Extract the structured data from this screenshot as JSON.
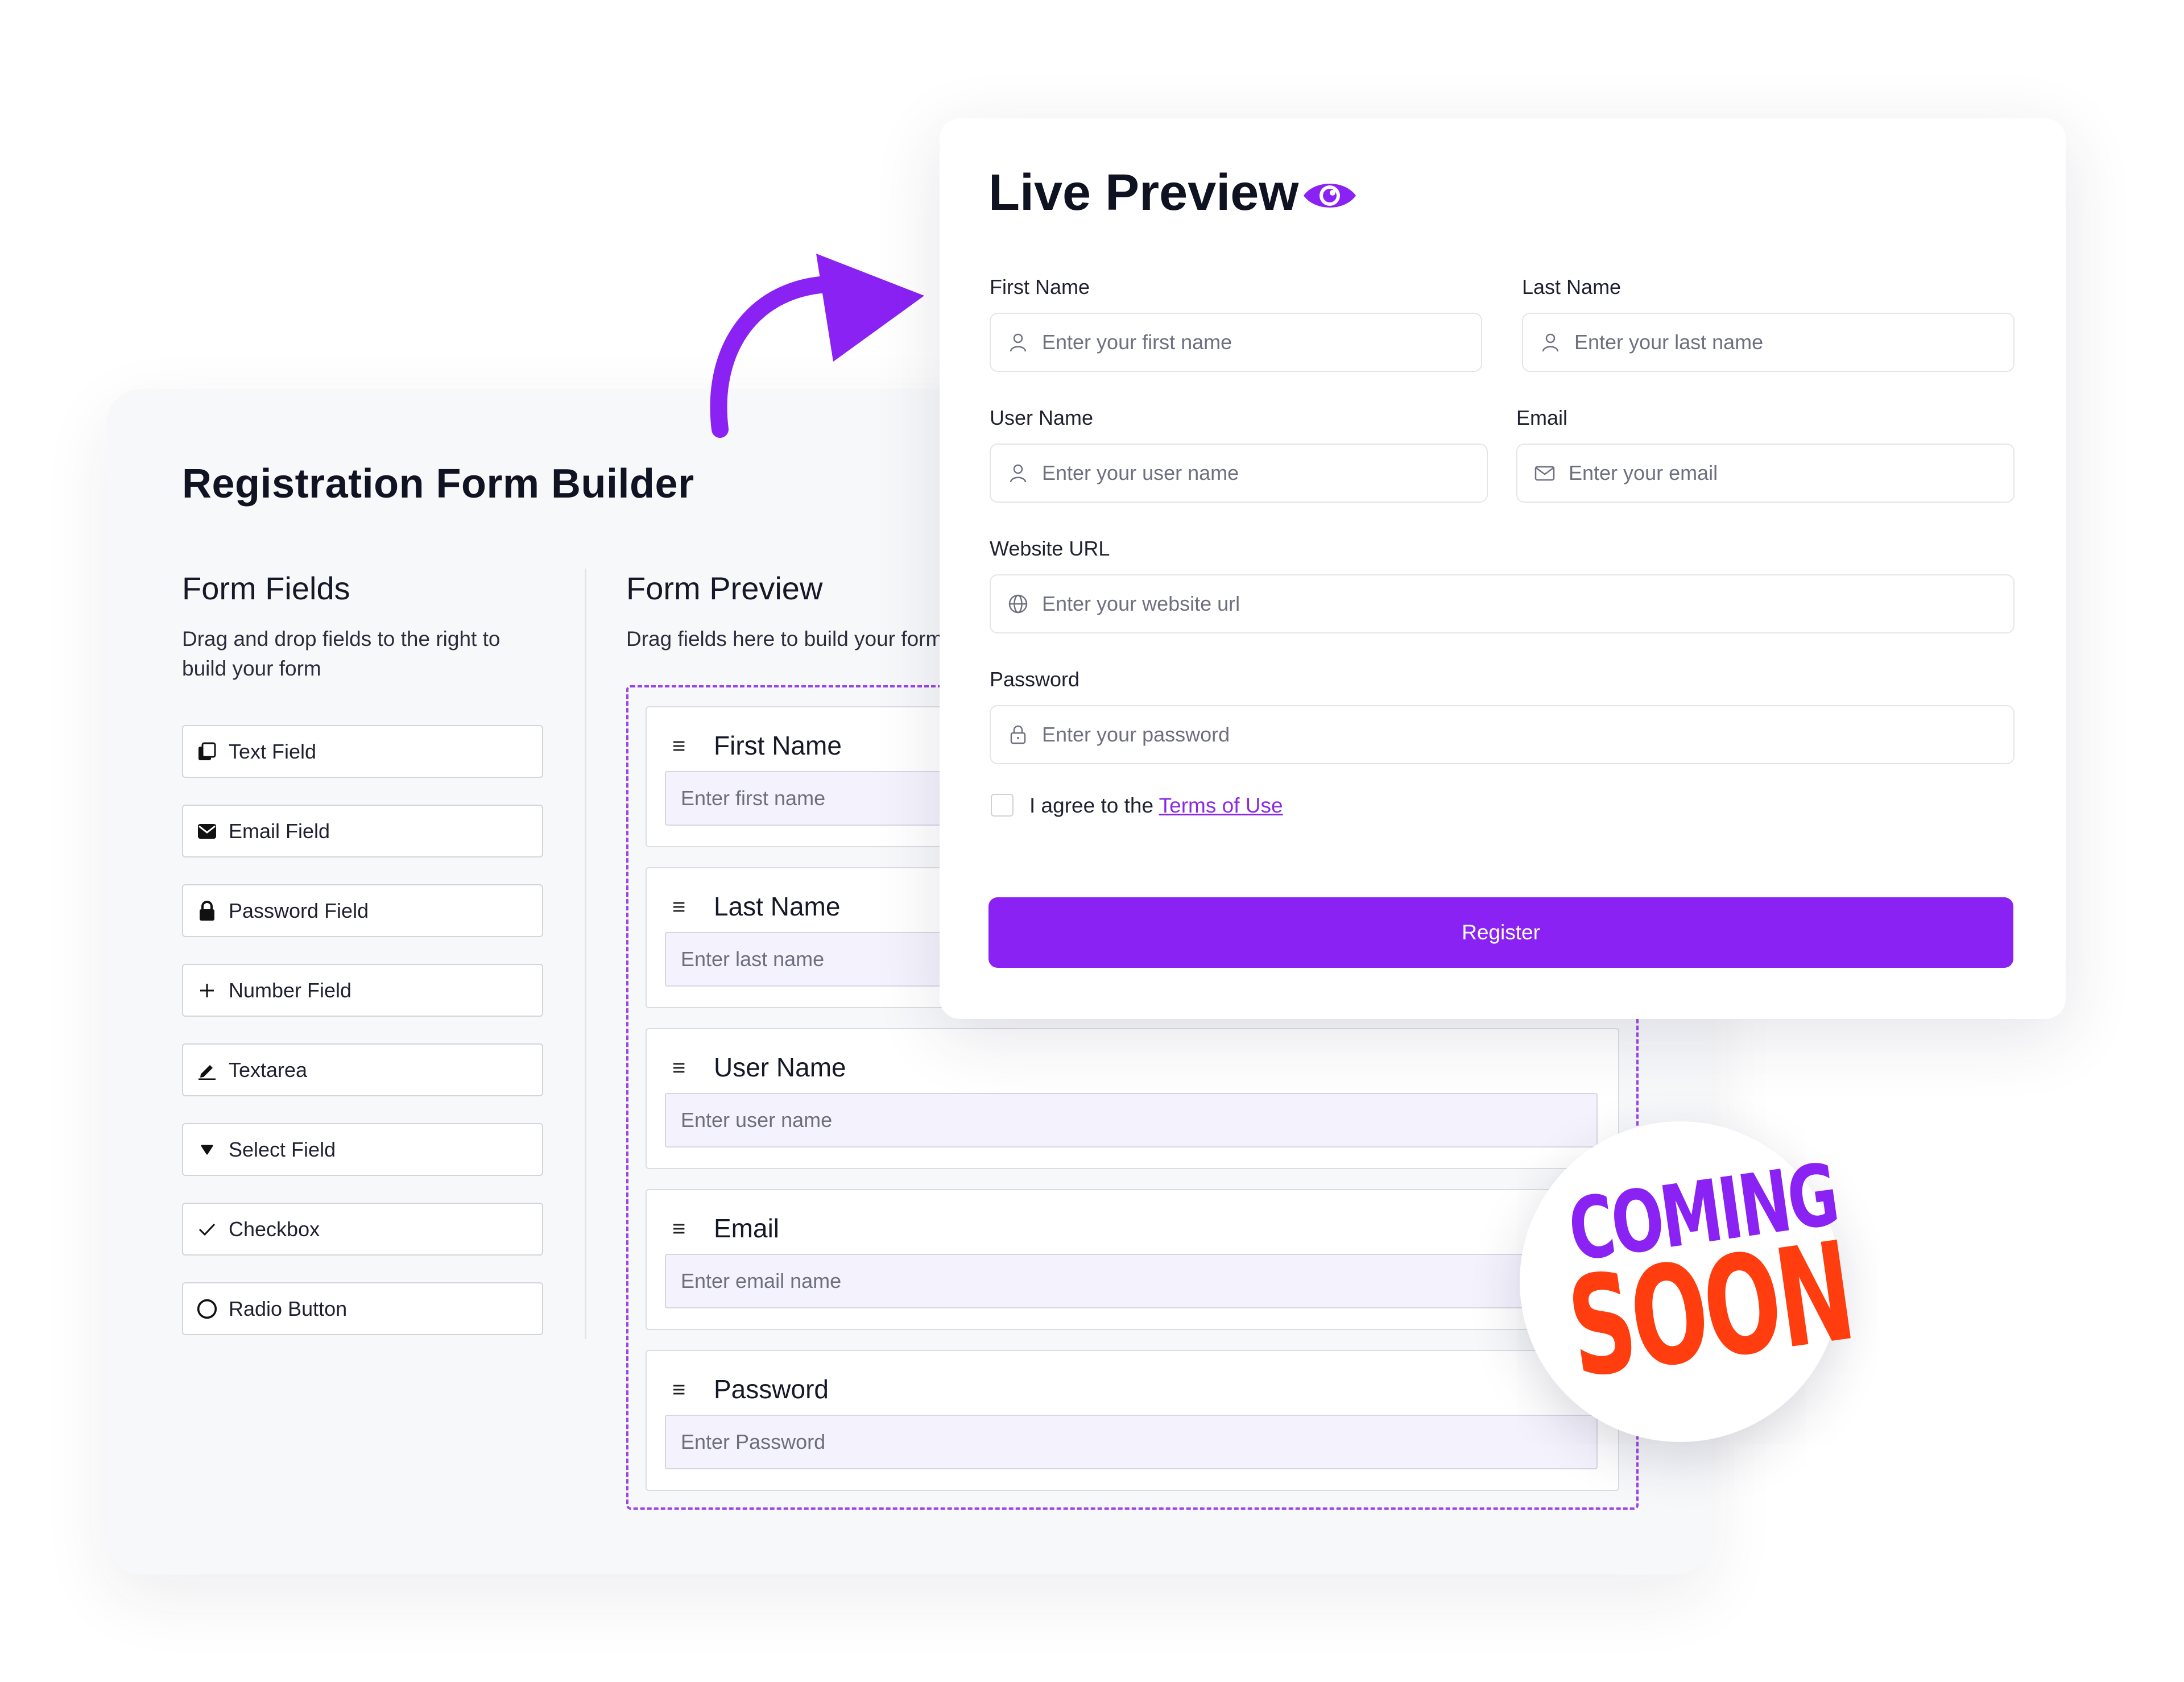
{
  "builder": {
    "title": "Registration Form Builder",
    "form_fields": {
      "title": "Form Fields",
      "description": "Drag and drop fields to the right to build your form",
      "items": [
        {
          "label": "Text Field",
          "icon": "copy-icon"
        },
        {
          "label": "Email Field",
          "icon": "envelope-icon"
        },
        {
          "label": "Password Field",
          "icon": "lock-icon"
        },
        {
          "label": "Number Field",
          "icon": "plus-icon"
        },
        {
          "label": "Textarea",
          "icon": "pencil-icon"
        },
        {
          "label": "Select Field",
          "icon": "caret-icon"
        },
        {
          "label": "Checkbox",
          "icon": "check-icon"
        },
        {
          "label": "Radio Button",
          "icon": "circle-icon"
        }
      ]
    },
    "form_preview": {
      "title": "Form Preview",
      "description": "Drag fields here to build your form",
      "fields": [
        {
          "label": "First Name",
          "placeholder": "Enter first name"
        },
        {
          "label": "Last Name",
          "placeholder": "Enter last name"
        },
        {
          "label": "User Name",
          "placeholder": "Enter user name"
        },
        {
          "label": "Email",
          "placeholder": "Enter email name"
        },
        {
          "label": "Password",
          "placeholder": "Enter Password"
        }
      ]
    }
  },
  "live_preview": {
    "title": "Live Preview",
    "first_name": {
      "label": "First Name",
      "placeholder": "Enter your first name"
    },
    "last_name": {
      "label": "Last Name",
      "placeholder": "Enter your last name"
    },
    "user_name": {
      "label": "User Name",
      "placeholder": "Enter your user name"
    },
    "email": {
      "label": "Email",
      "placeholder": "Enter your email"
    },
    "website": {
      "label": "Website URL",
      "placeholder": "Enter your website url"
    },
    "password": {
      "label": "Password",
      "placeholder": "Enter your password"
    },
    "agree_text": "I agree to the ",
    "terms_link": "Terms of Use",
    "register_label": "Register"
  },
  "badge": {
    "line1": "COMING",
    "line2": "SOON"
  },
  "colors": {
    "accent": "#8a22f3",
    "orange": "#ff3d0f",
    "dashed": "#9b45e6"
  }
}
